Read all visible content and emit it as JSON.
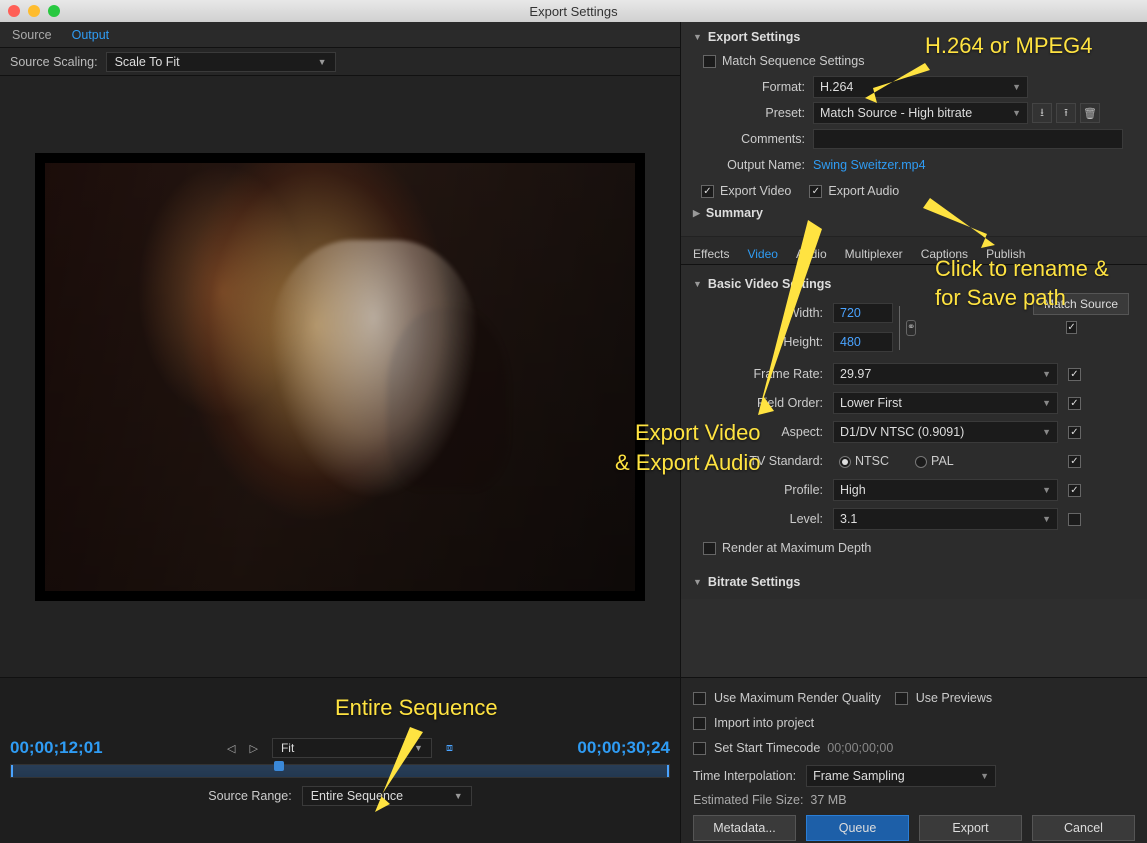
{
  "window": {
    "title": "Export Settings"
  },
  "left": {
    "tabs": {
      "source": "Source",
      "output": "Output"
    },
    "source_scaling_label": "Source Scaling:",
    "source_scaling_value": "Scale To Fit"
  },
  "export_settings": {
    "header": "Export Settings",
    "match_seq_label": "Match Sequence Settings",
    "format_label": "Format:",
    "format_value": "H.264",
    "preset_label": "Preset:",
    "preset_value": "Match Source - High bitrate",
    "comments_label": "Comments:",
    "output_name_label": "Output Name:",
    "output_name_value": "Swing Sweitzer.mp4",
    "export_video_label": "Export Video",
    "export_audio_label": "Export Audio",
    "summary_label": "Summary"
  },
  "right_tabs": {
    "effects": "Effects",
    "video": "Video",
    "audio": "Audio",
    "multiplexer": "Multiplexer",
    "captions": "Captions",
    "publish": "Publish"
  },
  "video_settings": {
    "header": "Basic Video Settings",
    "match_source_btn": "Match Source",
    "width_label": "Width:",
    "width_value": "720",
    "height_label": "Height:",
    "height_value": "480",
    "frame_rate_label": "Frame Rate:",
    "frame_rate_value": "29.97",
    "field_order_label": "Field Order:",
    "field_order_value": "Lower First",
    "aspect_label": "Aspect:",
    "aspect_value": "D1/DV NTSC (0.9091)",
    "tv_std_label": "TV Standard:",
    "tv_ntsc": "NTSC",
    "tv_pal": "PAL",
    "profile_label": "Profile:",
    "profile_value": "High",
    "level_label": "Level:",
    "level_value": "3.1",
    "render_max_depth": "Render at Maximum Depth",
    "bitrate_header": "Bitrate Settings"
  },
  "timecode": {
    "current": "00;00;12;01",
    "fit_label": "Fit",
    "duration": "00;00;30;24",
    "source_range_label": "Source Range:",
    "source_range_value": "Entire Sequence"
  },
  "bottom_right": {
    "max_quality": "Use Maximum Render Quality",
    "use_previews": "Use Previews",
    "import_project": "Import into project",
    "set_start_tc": "Set Start Timecode",
    "start_tc_value": "00;00;00;00",
    "time_interp_label": "Time Interpolation:",
    "time_interp_value": "Frame Sampling",
    "est_label": "Estimated File Size:",
    "est_value": "37 MB",
    "metadata_btn": "Metadata...",
    "queue_btn": "Queue",
    "export_btn": "Export",
    "cancel_btn": "Cancel"
  },
  "annotations": {
    "a1": "H.264 or MPEG4",
    "a2_line1": "Click to rename &",
    "a2_line2": "for Save path",
    "a3_line1": "Export Video",
    "a3_line2": "& Export Audio",
    "a4": "Entire Sequence"
  }
}
